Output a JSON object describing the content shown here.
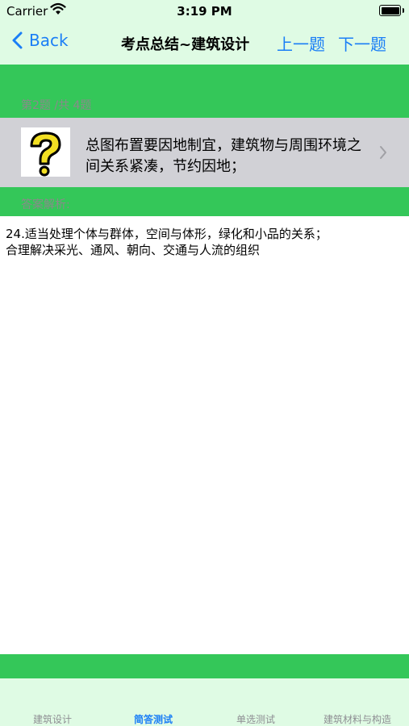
{
  "status": {
    "carrier": "Carrier",
    "time": "3:19 PM"
  },
  "nav": {
    "back_label": "Back",
    "title": "考点总结~建筑设计",
    "prev_label": "上一题",
    "next_label": "下一题"
  },
  "question": {
    "counter": "第2题 /共 4题",
    "text": "总图布置要因地制宜，建筑物与周围环境之间关系紧凑，节约因地；",
    "icon": "question-mark-icon"
  },
  "answer": {
    "label": "答案解析:",
    "text": "24.适当处理个体与群体，空间与体形，绿化和小品的关系；\n合理解决采光、通风、朝向、交通与人流的组织"
  },
  "tabs": [
    {
      "label": "建筑设计",
      "active": false
    },
    {
      "label": "简答测试",
      "active": true
    },
    {
      "label": "单选测试",
      "active": false
    },
    {
      "label": "建筑材料与构造",
      "active": false
    }
  ],
  "colors": {
    "accent": "#1a7ef6",
    "green": "#34c759",
    "light_green": "#dffbe4",
    "cell_gray": "#d1d1d6"
  }
}
